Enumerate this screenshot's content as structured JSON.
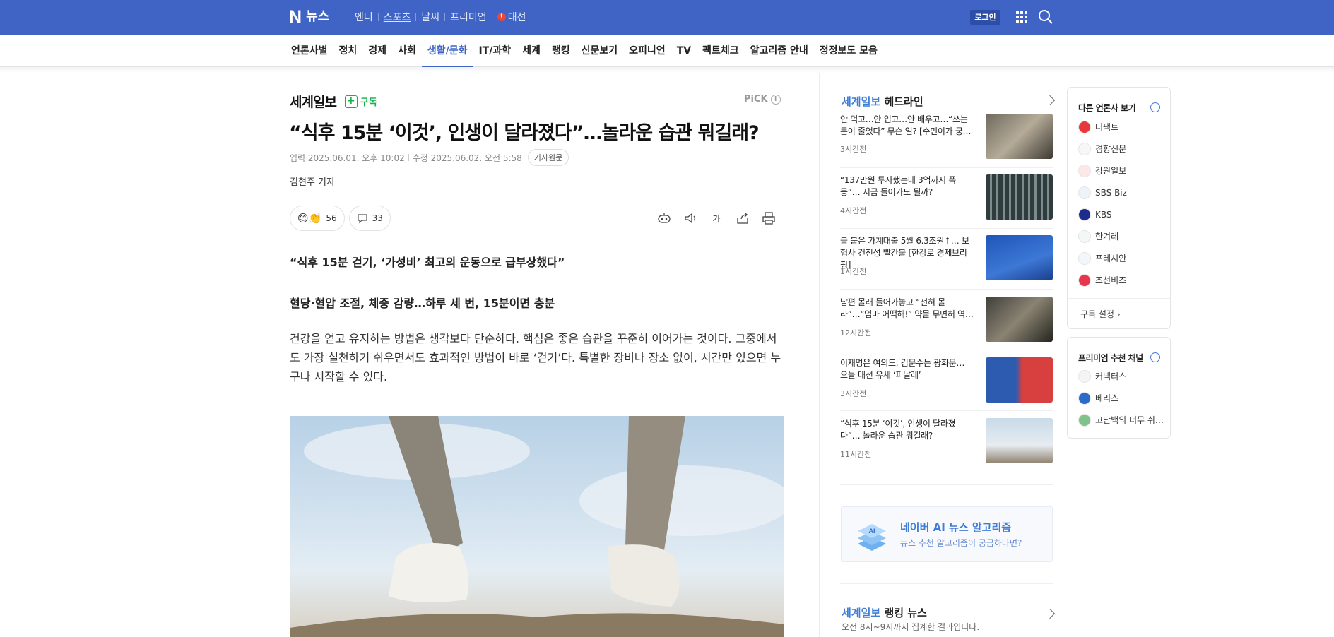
{
  "header": {
    "logo_n": "N",
    "logo_text": "뉴스",
    "services": [
      "엔터",
      "스포츠",
      "날씨",
      "프리미엄"
    ],
    "election": "대선",
    "login": "로그인"
  },
  "nav": {
    "items": [
      "언론사별",
      "정치",
      "경제",
      "사회",
      "생활/문화",
      "IT/과학",
      "세계",
      "랭킹",
      "신문보기",
      "오피니언",
      "TV",
      "팩트체크",
      "알고리즘 안내",
      "정정보도 모음"
    ],
    "active": "생활/문화"
  },
  "article": {
    "press": "세계일보",
    "subscribe": "구독",
    "pick": "PiCK",
    "title": "“식후 15분 ‘이것’, 인생이 달라졌다”…놀라운 습관 뭐길래?",
    "input_date": "입력 2025.06.01. 오후 10:02",
    "modified_date": "수정 2025.06.02. 오전 5:58",
    "original_link": "기사원문",
    "reporter": "김현주 기자",
    "reaction_count": "56",
    "comment_count": "33",
    "font_tool": "가",
    "subtitle1": "“식후 15분 걷기, ‘가성비’ 최고의 운동으로 급부상했다”",
    "subtitle2": "혈당·혈압 조절, 체중 감량…하루 세 번, 15분이면 충분",
    "body": "건강을 얻고 유지하는 방법은 생각보다 단순하다. 핵심은 좋은 습관을 꾸준히 이어가는 것이다. 그중에서도 가장 실천하기 쉬우면서도 효과적인 방법이 바로 ‘걷기’다. 특별한 장비나 장소 없이, 시간만 있으면 누구나 시작할 수 있다."
  },
  "headlines": {
    "press": "세계일보",
    "label": "헤드라인",
    "items": [
      {
        "title": "안 먹고…안 입고…안 배우고…“쓰는 돈이 줄었다” 무슨 일? [수민이가 궁…",
        "time": "3시간전"
      },
      {
        "title": "“137만원 투자했는데 3억까지 폭등”… 지금 들어가도 될까?",
        "time": "4시간전"
      },
      {
        "title": "불 붙은 가계대출 5월 6.3조원↑… 보험사 건전성 빨간불 [한강로 경제브리핑]",
        "time": "1시간전"
      },
      {
        "title": "남편 몰래 들어가놓고 “전혀 몰라”…“엄마 어떡해!” 약물 무면허 역…",
        "time": "12시간전"
      },
      {
        "title": "이재명은 여의도, 김문수는 광화문… 오늘 대선 유세 ‘피날레’",
        "time": "3시간전"
      },
      {
        "title": "“식후 15분 ‘이것’, 인생이 달라졌다”… 놀라운 습관 뭐길래?",
        "time": "11시간전"
      }
    ]
  },
  "ai_box": {
    "title": "네이버 AI 뉴스 알고리즘",
    "subtitle": "뉴스 추천 알고리즘이 궁금하다면?",
    "icon_text": "AI"
  },
  "ranking": {
    "press": "세계일보",
    "label": "랭킹 뉴스",
    "sub": "오전 8시~9시까지 집계한 결과입니다."
  },
  "other_press": {
    "title": "다른 언론사 보기",
    "items": [
      "더팩트",
      "경향신문",
      "강원일보",
      "SBS Biz",
      "KBS",
      "한겨레",
      "프레시안",
      "조선비즈"
    ],
    "setting": "구독 설정"
  },
  "premium": {
    "title": "프리미엄 추천 채널",
    "items": [
      "커넥터스",
      "베리스",
      "고단백의 너무 쉬…"
    ]
  },
  "colors": {
    "brand_blue": "#3f64c5",
    "subscribe_green": "#13b34b",
    "link_blue": "#3f7dd6"
  }
}
